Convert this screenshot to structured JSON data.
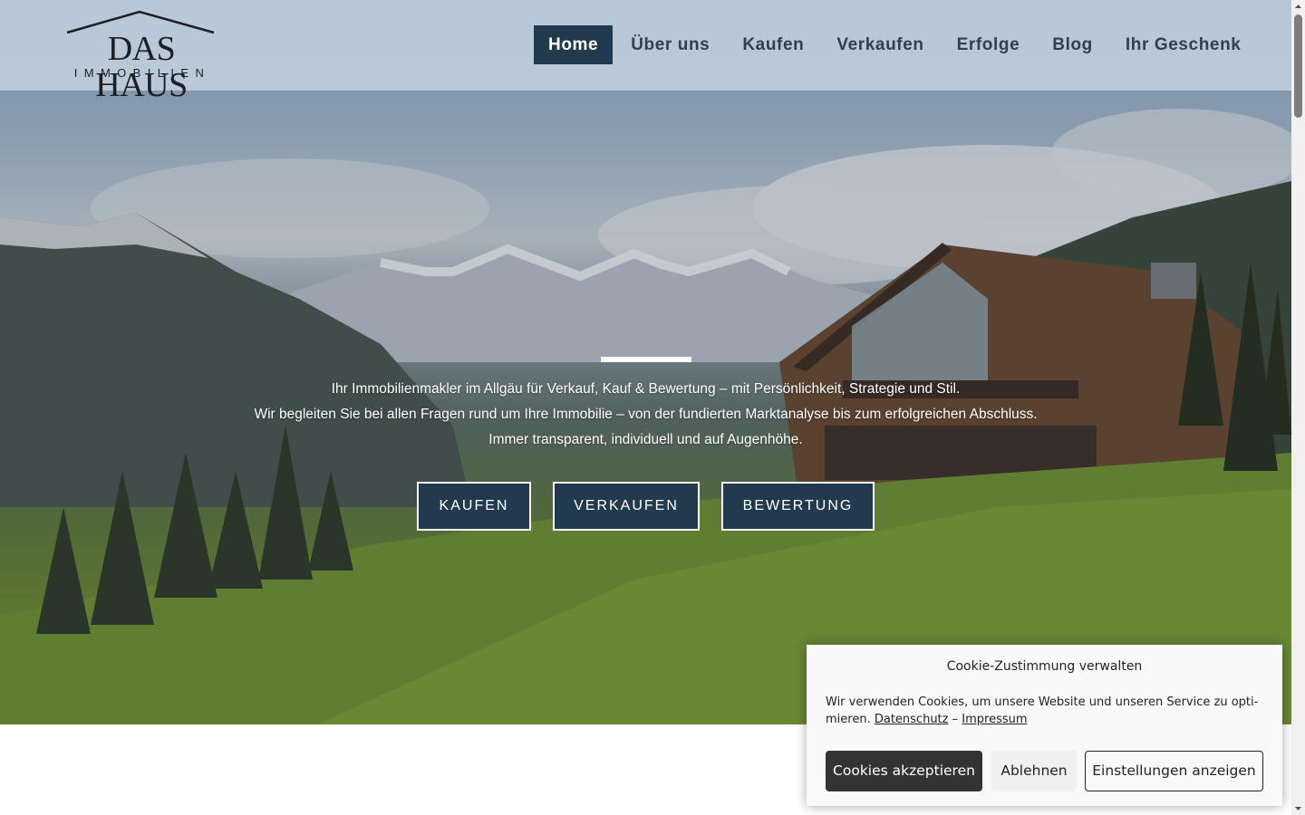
{
  "logo": {
    "line1": "DAS HAUS",
    "line2": "IMMOBILIEN"
  },
  "nav": {
    "items": [
      {
        "label": "Home",
        "active": true
      },
      {
        "label": "Über uns"
      },
      {
        "label": "Kaufen"
      },
      {
        "label": "Verkaufen"
      },
      {
        "label": "Erfolge"
      },
      {
        "label": "Blog"
      },
      {
        "label": "Ihr Geschenk"
      }
    ]
  },
  "hero": {
    "lines": [
      "Ihr Immobilienmakler im Allgäu für Verkauf, Kauf & Bewertung – mit Persönlichkeit, Strategie und Stil.",
      "Wir begleiten Sie bei allen Fragen rund um Ihre Immobilie – von der fundierten Marktanalyse bis zum erfolgreichen Abschluss.",
      "Immer transparent, individuell und auf Augenhöhe."
    ],
    "buttons": [
      "KAUFEN",
      "VERKAUFEN",
      "BEWERTUNG"
    ]
  },
  "cookie": {
    "title": "Cookie-Zustimmung verwalten",
    "text_line1": "Wir verwenden Cookies, um unsere Website und unseren Service zu opti-",
    "text_line2_prefix": "mieren.",
    "link_privacy": "Datenschutz",
    "separator": "–",
    "link_imprint": "Impressum",
    "accept_label": "Cookies akzeptieren",
    "deny_label": "Ablehnen",
    "settings_label": "Einstellungen anzeigen"
  },
  "colors": {
    "nav_active_bg": "#213a4d",
    "nav_text": "#2c4252",
    "cta_bg": "#213a4d",
    "cookie_accept_bg": "#333333"
  },
  "icons": [
    "house-roof-icon",
    "scroll-up-arrow-icon",
    "scroll-down-arrow-icon"
  ]
}
